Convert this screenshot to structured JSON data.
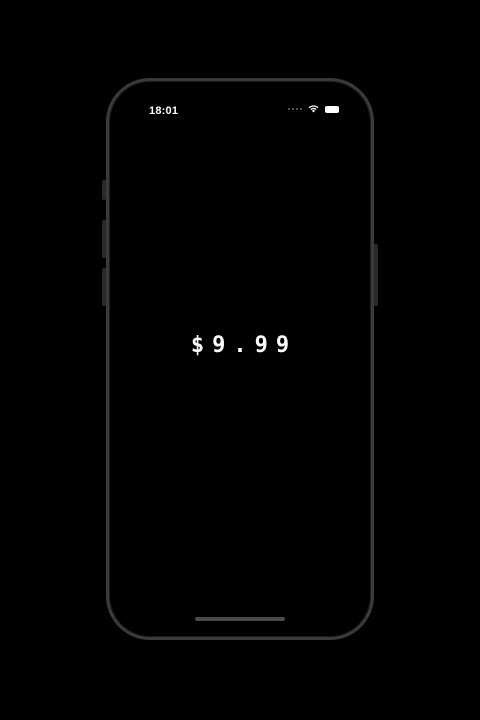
{
  "status_bar": {
    "time": "18:01",
    "wifi_icon": "wifi-icon",
    "battery_icon": "battery-icon"
  },
  "main": {
    "price": "$9.99"
  }
}
